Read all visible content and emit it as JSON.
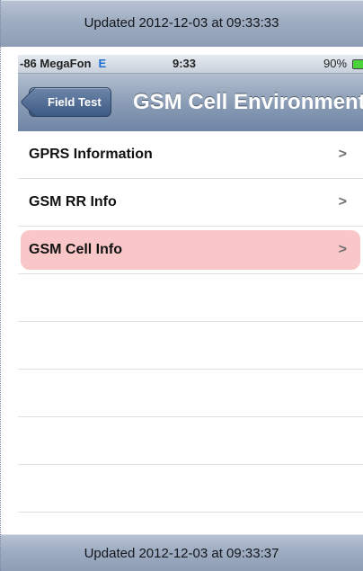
{
  "top_banner": {
    "text": "Updated 2012-12-03 at 09:33:33"
  },
  "status_bar": {
    "carrier": "-86 MegaFon",
    "network": "E",
    "time": "9:33",
    "battery": "90%",
    "battery_level": 0.9
  },
  "nav": {
    "back_label": "Field Test",
    "title": "GSM Cell Environment"
  },
  "rows": [
    {
      "label": "GPRS Information",
      "selected": false
    },
    {
      "label": "GSM RR Info",
      "selected": false
    },
    {
      "label": "GSM Cell Info",
      "selected": true
    }
  ],
  "chevron": ">",
  "bottom_banner": {
    "text": "Updated 2012-12-03 at 09:33:37"
  },
  "colors": {
    "selected_row": "#f9c7c7",
    "network_indicator": "#1f6fd1",
    "battery_fill": "#4cd23d"
  }
}
